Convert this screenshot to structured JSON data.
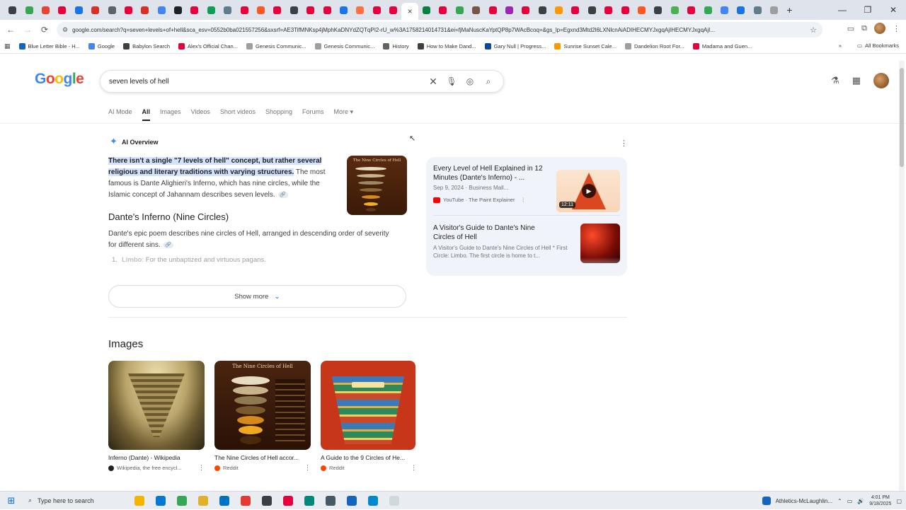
{
  "browser": {
    "tab_favicon_colors": [
      "#3c4043",
      "#34a853",
      "#ea4335",
      "#e8003d",
      "#1a73e8",
      "#d93025",
      "#5f6368",
      "#e8003d",
      "#d93025",
      "#4285f4",
      "#202124",
      "#e8003d",
      "#0f9d58",
      "#607d8b",
      "#e8003d",
      "#ff5722",
      "#e8003d",
      "#3c4043",
      "#e8003d",
      "#e8003d",
      "#1a73e8",
      "#ff7043",
      "#e8003d",
      "#e8003d",
      "#0b8043",
      "#e8003d",
      "#34a853",
      "#795548",
      "#e8003d",
      "#9c27b0",
      "#e8003d",
      "#3c4043",
      "#ff9800",
      "#e8003d",
      "#3c4043",
      "#e8003d",
      "#e8003d",
      "#ff5722",
      "#3c4043",
      "#4caf50",
      "#e8003d",
      "#34a853",
      "#4285f4",
      "#1a73e8",
      "#607d8b",
      "#9e9e9e"
    ],
    "active_tab_close": "×",
    "new_tab": "+",
    "window_controls": [
      "—",
      "❐",
      "✕"
    ],
    "url": "google.com/search?q=seven+levels+of+hell&sca_esv=0552b0ba021557256&sxsrf=AE3TifMNKsp4jMphKaDNYdZQTqPI2-rU_w%3A1758214014731&ei=fjMaNuscKaYptQP8p7WAcBcoq=&gs_lp=Egxnd3Mtd2l6LXNlcnAiADIHECMYJxgqAjIHECMYJxgqAjI...",
    "bookmarks": [
      {
        "label": "Blue Letter Bible - H...",
        "color": "#1565c0"
      },
      {
        "label": "Google",
        "color": "#4285f4"
      },
      {
        "label": "Babylon Search",
        "color": "#3c4043"
      },
      {
        "label": "Alex's Official Chan...",
        "color": "#e8003d"
      },
      {
        "label": "Genesis Communic...",
        "color": "#9e9e9e"
      },
      {
        "label": "Genesis Communic...",
        "color": "#9e9e9e"
      },
      {
        "label": "History",
        "color": "#5f6368"
      },
      {
        "label": "How to Make Dand...",
        "color": "#3c4043"
      },
      {
        "label": "Gary Null | Progress...",
        "color": "#0d47a1"
      },
      {
        "label": "Sunrise Sunset Cale...",
        "color": "#ff9800"
      },
      {
        "label": "Dandelion Root For...",
        "color": "#9e9e9e"
      },
      {
        "label": "Madama and Guen...",
        "color": "#e8003d"
      }
    ],
    "all_bookmarks": "All Bookmarks"
  },
  "google": {
    "logo": "Google",
    "query": "seven levels of hell",
    "filters": [
      "AI Mode",
      "All",
      "Images",
      "Videos",
      "Short videos",
      "Shopping",
      "Forums",
      "More"
    ],
    "active_filter": "All",
    "ai_overview": {
      "label": "AI Overview",
      "highlight": "There isn't a single \"7 levels of hell\" concept, but rather several religious and literary traditions with varying structures.",
      "rest": " The most famous is Dante Alighieri's Inferno, which has nine circles, while the Islamic concept of Jahannam describes seven levels.",
      "section_title": "Dante's Inferno (Nine Circles)",
      "section_text": "Dante's epic poem describes nine circles of Hell, arranged in descending order of severity for different sins.",
      "list_num": "1.",
      "list_term": "Limbo",
      "list_text": ": For the unbaptized and virtuous pagans.",
      "show_more": "Show more",
      "thumb_title": "The Nine Circles of Hell"
    },
    "cards": [
      {
        "title": "Every Level of Hell Explained in 12 Minutes (Dante's Inferno) - ...",
        "date": "Sep 9, 2024",
        "channel": "Business Mall...",
        "source": "YouTube · The Paint Explainer",
        "duration": "12:11"
      },
      {
        "title": "A Visitor's Guide to Dante's Nine Circles of Hell",
        "snippet": "A Visitor's Guide to Dante's Nine Circles of Hell * First Circle: Limbo. The first circle is home to t..."
      }
    ],
    "images_heading": "Images",
    "images": [
      {
        "caption": "Inferno (Dante) - Wikipedia",
        "source": "Wikipedia, the free encycl...",
        "dot": "#202124"
      },
      {
        "caption": "The Nine Circles of Hell accor...",
        "source": "Reddit",
        "dot": "#ff4500"
      },
      {
        "caption": "A Guide to the 9 Circles of He...",
        "source": "Reddit",
        "dot": "#ff4500"
      }
    ]
  },
  "taskbar": {
    "search_placeholder": "Type here to search",
    "icon_colors": [
      "#f4b400",
      "#0078d4",
      "#34a853",
      "#e1b12c",
      "#0072c6",
      "#e53935",
      "#3c4043",
      "#e8003d",
      "#00897b",
      "#455a64",
      "#1565c0",
      "#0288d1",
      "#cfd8dc"
    ],
    "notification": "Athletics-McLaughlin...",
    "time": "4:01 PM",
    "date": "9/18/2025"
  }
}
